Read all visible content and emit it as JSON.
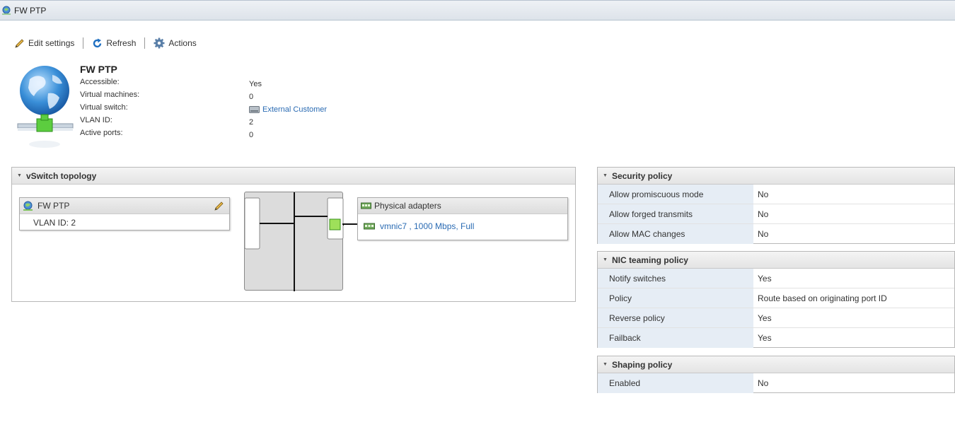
{
  "window": {
    "title": "FW PTP"
  },
  "toolbar": {
    "edit_label": "Edit settings",
    "refresh_label": "Refresh",
    "actions_label": "Actions"
  },
  "info": {
    "name": "FW PTP",
    "rows": [
      {
        "label": "Accessible:",
        "value": "Yes"
      },
      {
        "label": "Virtual machines:",
        "value": "0"
      },
      {
        "label": "Virtual switch:",
        "value": "External Customer"
      },
      {
        "label": "VLAN ID:",
        "value": "2"
      },
      {
        "label": "Active ports:",
        "value": "0"
      }
    ]
  },
  "topology": {
    "title": "vSwitch topology",
    "portgroup": {
      "name": "FW PTP",
      "vlan": "VLAN ID: 2"
    },
    "adapters": {
      "title": "Physical adapters",
      "nic": "vmnic7 , 1000 Mbps, Full"
    }
  },
  "security": {
    "title": "Security policy",
    "rows": [
      {
        "key": "Allow promiscuous mode",
        "value": "No"
      },
      {
        "key": "Allow forged transmits",
        "value": "No"
      },
      {
        "key": "Allow MAC changes",
        "value": "No"
      }
    ]
  },
  "nic_teaming": {
    "title": "NIC teaming policy",
    "rows": [
      {
        "key": "Notify switches",
        "value": "Yes"
      },
      {
        "key": "Policy",
        "value": "Route based on originating port ID"
      },
      {
        "key": "Reverse policy",
        "value": "Yes"
      },
      {
        "key": "Failback",
        "value": "Yes"
      }
    ]
  },
  "shaping": {
    "title": "Shaping policy",
    "rows": [
      {
        "key": "Enabled",
        "value": "No"
      }
    ]
  },
  "colors": {
    "link": "#2a6bb3",
    "key_bg": "#e6edf5",
    "port_green": "#7ed321"
  },
  "icons": [
    "portgroup-icon",
    "pencil-icon",
    "refresh-icon",
    "gear-icon",
    "globe-network-icon",
    "switch-icon",
    "nic-icon"
  ]
}
